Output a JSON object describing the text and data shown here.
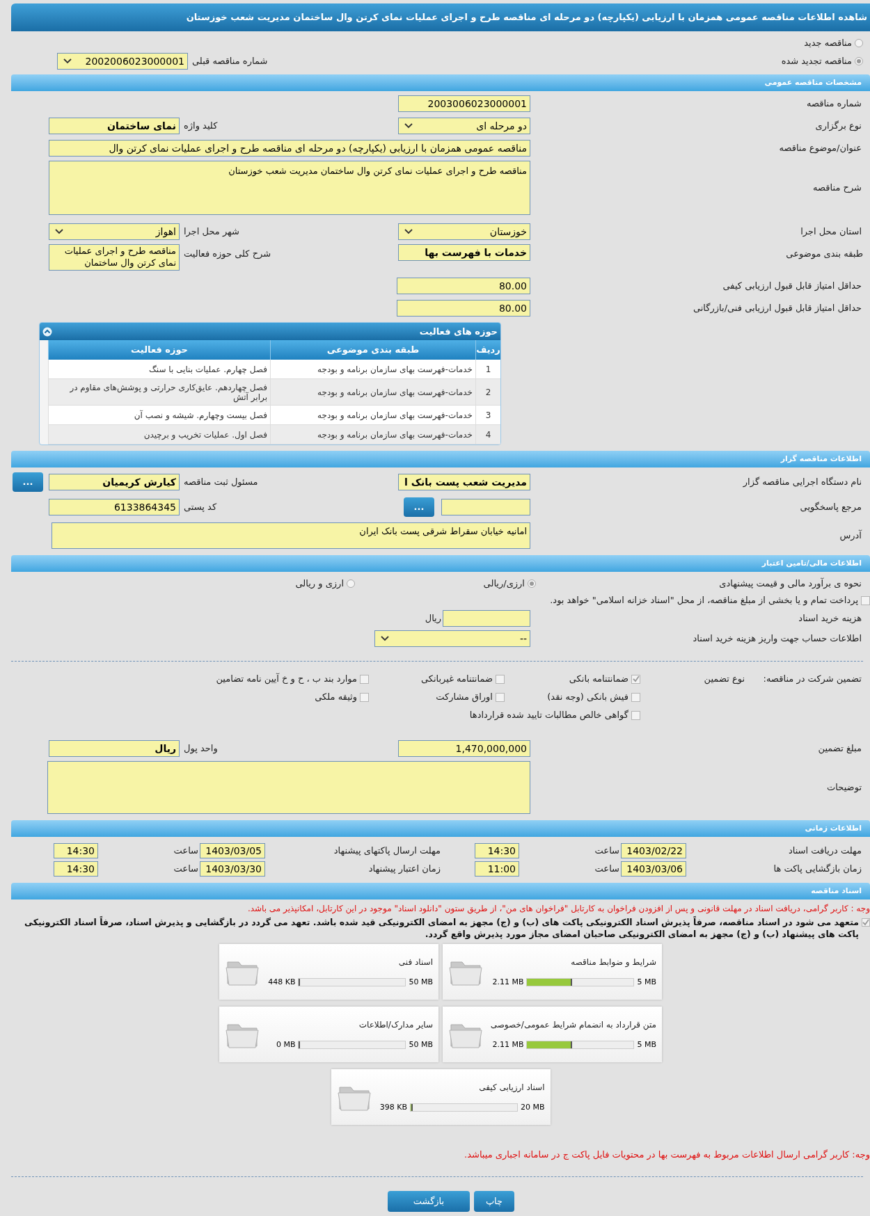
{
  "title": "شاهده اطلاعات مناقصه عمومی همزمان با ارزیابی (یکپارچه) دو مرحله ای مناقصه طرح و اجرای عملیات نمای کرتن وال ساختمان مدیریت شعب خوزستان",
  "tender_type": [
    {
      "label": "مناقصه جدید",
      "selected": false
    },
    {
      "label": "مناقصه تجدید شده",
      "selected": true
    }
  ],
  "previous_tender": {
    "label": "شماره مناقصه قبلی",
    "value": "2002006023000001"
  },
  "general": {
    "header": "مشخصات مناقصه عمومی",
    "tender_number": {
      "label": "شماره مناقصه",
      "value": "2003006023000001"
    },
    "holding_type": {
      "label": "نوع برگزاری",
      "value": "دو مرحله ای"
    },
    "keyword": {
      "label": "کلید واژه",
      "value": "نمای ساختمان"
    },
    "subject": {
      "label": "عنوان/موضوع مناقصه",
      "value": "مناقصه عمومی همزمان با ارزیابی (یکپارچه) دو مرحله ای مناقصه طرح و اجرای عملیات نمای کرتن وال"
    },
    "description": {
      "label": "شرح مناقصه",
      "value": "مناقصه طرح و اجرای عملیات نمای کرتن وال ساختمان مدیریت شعب خوزستان"
    },
    "province": {
      "label": "استان محل اجرا",
      "value": "خوزستان"
    },
    "city": {
      "label": "شهر محل اجرا",
      "value": "اهواز"
    },
    "category": {
      "label": "طبقه بندی موضوعی",
      "value": "خدمات با فهرست بها"
    },
    "activity_scope": {
      "label": "شرح کلی حوزه فعالیت",
      "value": "مناقصه طرح و اجرای عملیات نمای کرتن وال ساختمان"
    },
    "min_quality_score": {
      "label": "حداقل امتیاز قابل قبول ارزیابی کیفی",
      "value": "80.00"
    },
    "min_technical_score": {
      "label": "حداقل امتیاز قابل قبول ارزیابی فنی/بازرگانی",
      "value": "80.00"
    }
  },
  "activities": {
    "title": "حوزه های فعالیت",
    "columns": [
      "ردیف",
      "طبقه بندی موضوعی",
      "حوزه فعالیت"
    ],
    "rows": [
      [
        "1",
        "خدمات-فهرست بهای سازمان برنامه و بودجه",
        "فصل چهارم. عملیات بنایی با سنگ"
      ],
      [
        "2",
        "خدمات-فهرست بهای سازمان برنامه و بودجه",
        "فصل چهاردهم. عایق‌کاری حرارتی و پوشش‌های مقاوم در برابر آتش"
      ],
      [
        "3",
        "خدمات-فهرست بهای سازمان برنامه و بودجه",
        "فصل بیست وچهارم. شیشه و نصب آن"
      ],
      [
        "4",
        "خدمات-فهرست بهای سازمان برنامه و بودجه",
        "فصل اول. عملیات تخریب و برچیدن"
      ]
    ]
  },
  "organizer": {
    "header": "اطلاعات مناقصه گزار",
    "agency": {
      "label": "نام دستگاه اجرایی مناقصه گزار",
      "value": "مدیریت شعب پست بانک ا"
    },
    "registrar": {
      "label": "مسئول ثبت مناقصه",
      "value": "کیارش کریمیان"
    },
    "reference": {
      "label": "مرجع پاسخگویی"
    },
    "postal_code": {
      "label": "کد پستی",
      "value": "6133864345"
    },
    "address": {
      "label": "آدرس",
      "value": "امانیه خیابان سقراط شرقی پست بانک ایران"
    },
    "more_button": "..."
  },
  "finance": {
    "header": "اطلاعات مالی/تامین اعتبار",
    "estimate_label": "نحوه ی برآورد مالی و قیمت پیشنهادی",
    "estimate_options": [
      {
        "label": "ارزی/ریالی",
        "selected": true
      },
      {
        "label": "ارزی و ریالی",
        "selected": false
      }
    ],
    "treasury": {
      "label": "پرداخت تمام و یا بخشی از مبلغ مناقصه، از محل \"اسناد خزانه اسلامی\" خواهد بود.",
      "checked": false
    },
    "doc_fee": {
      "label": "هزینه خرید اسناد",
      "unit": "ریال"
    },
    "account": {
      "label": "اطلاعات حساب جهت واریز هزینه خرید اسناد",
      "value": "--"
    }
  },
  "guarantee": {
    "label": "تضمین شرکت در مناقصه:",
    "type_label": "نوع تضمین",
    "options": [
      {
        "label": "ضمانتنامه بانکی",
        "checked": true
      },
      {
        "label": "ضمانتنامه غیربانکی",
        "checked": false
      },
      {
        "label": "موارد بند ب ، ح و خ آیین نامه تضامین",
        "checked": false
      },
      {
        "label": "فیش بانکی (وجه نقد)",
        "checked": false
      },
      {
        "label": "اوراق مشارکت",
        "checked": false
      },
      {
        "label": "وثیقه ملکی",
        "checked": false
      },
      {
        "label": "گواهی خالص مطالبات تایید شده قراردادها",
        "checked": false
      }
    ],
    "amount": {
      "label": "مبلغ تضمین",
      "value": "1,470,000,000"
    },
    "currency": {
      "label": "واحد پول",
      "value": "ریال"
    },
    "notes": {
      "label": "توضیحات"
    }
  },
  "schedule": {
    "header": "اطلاعات زمانی",
    "rows": [
      [
        {
          "label": "مهلت دریافت اسناد",
          "date": "1403/02/22",
          "time_label": "ساعت",
          "time": "14:30"
        },
        {
          "label": "مهلت ارسال پاکتهای پیشنهاد",
          "date": "1403/03/05",
          "time_label": "ساعت",
          "time": "14:30"
        }
      ],
      [
        {
          "label": "زمان بازگشایی پاکت ها",
          "date": "1403/03/06",
          "time_label": "ساعت",
          "time": "11:00"
        },
        {
          "label": "زمان اعتبار پیشنهاد",
          "date": "1403/03/30",
          "time_label": "ساعت",
          "time": "14:30"
        }
      ]
    ]
  },
  "documents": {
    "header": "اسناد مناقصه",
    "notice": "وجه : کاربر گرامی، دریافت اسناد در مهلت قانونی و پس از افزودن فراخوان به کارتابل \"فراخوان های من\"، از طریق ستون \"دانلود اسناد\" موجود در این کارتابل، امکانپذیر می باشد.",
    "commitment": {
      "text": "متعهد می شود در اسناد مناقصه، صرفاً پذیرش اسناد الکترونیکی پاکت های (ب) و (ج) مجهز به امضای الکترونیکی قید شده باشد. تعهد می گردد در بازگشایی و پذیرش اسناد، صرفاً اسناد الکترونیکی پاکت های پیشنهاد (ب) و (ج) مجهز به امضای الکترونیکی صاحبان امضای مجاز مورد پذیرش واقع گردد.",
      "checked": true
    },
    "files": [
      {
        "name": "شرایط و ضوابط مناقصه",
        "size": "2.11 MB",
        "max": "5 MB",
        "level": 0.42
      },
      {
        "name": "اسناد فنی",
        "size": "448 KB",
        "max": "50 MB",
        "level": 0.009
      },
      {
        "name": "متن قرارداد به انضمام شرایط عمومی/خصوصی",
        "size": "2.11 MB",
        "max": "5 MB",
        "level": 0.42
      },
      {
        "name": "سایر مدارک/اطلاعات",
        "size": "0 MB",
        "max": "50 MB",
        "level": 0
      },
      {
        "name": "اسناد ارزیابی کیفی",
        "size": "398 KB",
        "max": "20 MB",
        "level": 0.02
      }
    ],
    "footer_note": "وجه: کاربر گرامی ارسال اطلاعات مربوط به فهرست بها در محتویات فایل پاکت ج در سامانه اجباری میباشد."
  },
  "buttons": [
    "چاپ",
    "بازگشت"
  ]
}
